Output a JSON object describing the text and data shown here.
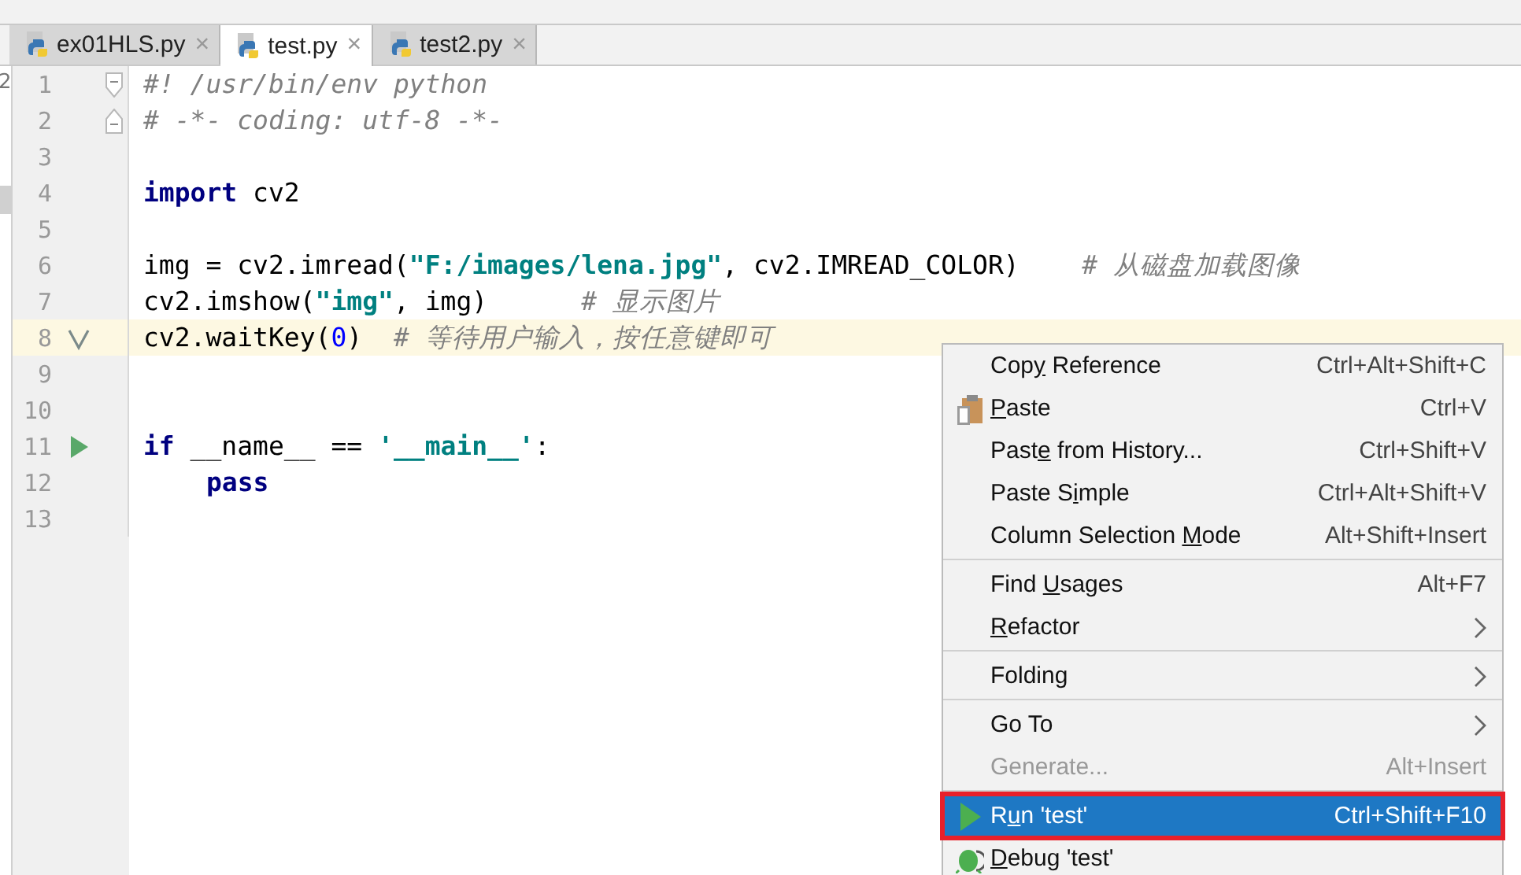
{
  "left_strip": {
    "text": "2"
  },
  "tabs": [
    {
      "label": "ex01HLS.py",
      "close": "×",
      "selected": false
    },
    {
      "label": "test.py",
      "close": "×",
      "selected": true
    },
    {
      "label": "test2.py",
      "close": "×",
      "selected": false
    }
  ],
  "editor": {
    "lines": [
      {
        "number": "1",
        "current": false,
        "kind": "fold-start",
        "tokens": [
          {
            "kind": "comment",
            "text": "#! /usr/bin/env python"
          }
        ]
      },
      {
        "number": "2",
        "current": false,
        "kind": "fold-end",
        "tokens": [
          {
            "kind": "comment",
            "text": "# -*- coding: utf-8 -*-"
          }
        ]
      },
      {
        "number": "3",
        "current": false,
        "kind": "plain"
      },
      {
        "number": "4",
        "current": false,
        "kind": "plain",
        "tokens": [
          {
            "kind": "keyword",
            "text": "import"
          },
          {
            "kind": "plain",
            "text": " cv2"
          }
        ]
      },
      {
        "number": "5",
        "current": false,
        "kind": "plain"
      },
      {
        "number": "6",
        "current": false,
        "kind": "plain",
        "tokens": [
          {
            "kind": "plain",
            "text": "img = cv2.imread("
          },
          {
            "kind": "string",
            "text": "\"F:/images/lena.jpg\""
          },
          {
            "kind": "plain",
            "text": ", cv2.IMREAD_COLOR)    "
          },
          {
            "kind": "comment",
            "text": "# 从磁盘加载图像"
          }
        ]
      },
      {
        "number": "7",
        "current": false,
        "kind": "plain",
        "tokens": [
          {
            "kind": "plain",
            "text": "cv2.imshow("
          },
          {
            "kind": "string",
            "text": "\"img\""
          },
          {
            "kind": "plain",
            "text": ", img)      "
          },
          {
            "kind": "comment",
            "text": "# 显示图片"
          }
        ]
      },
      {
        "number": "8",
        "current": true,
        "kind": "check",
        "tokens": [
          {
            "kind": "plain",
            "text": "cv2.waitKey("
          },
          {
            "kind": "number",
            "text": "0"
          },
          {
            "kind": "plain",
            "text": ")  "
          },
          {
            "kind": "comment",
            "text": "# 等待用户输入，按任意键即可"
          }
        ]
      },
      {
        "number": "9",
        "current": false,
        "kind": "plain"
      },
      {
        "number": "10",
        "current": false,
        "kind": "plain"
      },
      {
        "number": "11",
        "current": false,
        "kind": "run",
        "tokens": [
          {
            "kind": "keyword",
            "text": "if"
          },
          {
            "kind": "plain",
            "text": " __name__ == "
          },
          {
            "kind": "string",
            "text": "'__main__'"
          },
          {
            "kind": "plain",
            "text": ":"
          }
        ]
      },
      {
        "number": "12",
        "current": false,
        "kind": "plain",
        "indented": true,
        "tokens": [
          {
            "kind": "keyword",
            "text": "pass"
          }
        ]
      },
      {
        "number": "13",
        "current": false,
        "kind": "plain"
      }
    ]
  },
  "context_menu": {
    "groups": [
      [
        {
          "before": "Cop",
          "mnemonic": "y",
          "after": " Reference",
          "shortcut": "Ctrl+Alt+Shift+C",
          "kind": "plain",
          "disabled": false,
          "submenu": false,
          "selected": false,
          "framed": false
        },
        {
          "mnemonic": "P",
          "after": "aste",
          "shortcut": "Ctrl+V",
          "kind": "clipboard",
          "disabled": false,
          "submenu": false,
          "selected": false,
          "framed": false
        },
        {
          "before": "Past",
          "mnemonic": "e",
          "after": " from History...",
          "shortcut": "Ctrl+Shift+V",
          "kind": "plain",
          "disabled": false,
          "submenu": false,
          "selected": false,
          "framed": false
        },
        {
          "before": "Paste S",
          "mnemonic": "i",
          "after": "mple",
          "shortcut": "Ctrl+Alt+Shift+V",
          "kind": "plain",
          "disabled": false,
          "submenu": false,
          "selected": false,
          "framed": false
        },
        {
          "before": "Column Selection ",
          "mnemonic": "M",
          "after": "ode",
          "shortcut": "Alt+Shift+Insert",
          "kind": "plain",
          "disabled": false,
          "submenu": false,
          "selected": false,
          "framed": false
        }
      ],
      [
        {
          "before": "Find ",
          "mnemonic": "U",
          "after": "sages",
          "shortcut": "Alt+F7",
          "kind": "plain",
          "disabled": false,
          "submenu": false,
          "selected": false,
          "framed": false
        },
        {
          "mnemonic": "R",
          "after": "efactor",
          "kind": "plain",
          "disabled": false,
          "submenu": true,
          "selected": false,
          "framed": false
        }
      ],
      [
        {
          "before": "Folding",
          "kind": "plain",
          "disabled": false,
          "submenu": true,
          "selected": false,
          "framed": false
        }
      ],
      [
        {
          "before": "Go To",
          "kind": "plain",
          "disabled": false,
          "submenu": true,
          "selected": false,
          "framed": false
        },
        {
          "before": "Generate...",
          "shortcut": "Alt+Insert",
          "kind": "plain",
          "disabled": true,
          "submenu": false,
          "selected": false,
          "framed": false
        }
      ],
      [
        {
          "before": "R",
          "mnemonic": "u",
          "after": "n 'test'",
          "shortcut": "Ctrl+Shift+F10",
          "kind": "run",
          "disabled": false,
          "submenu": false,
          "selected": true,
          "framed": true
        },
        {
          "mnemonic": "D",
          "after": "ebug 'test'",
          "kind": "bug",
          "disabled": false,
          "submenu": false,
          "selected": false,
          "framed": false
        }
      ]
    ]
  }
}
